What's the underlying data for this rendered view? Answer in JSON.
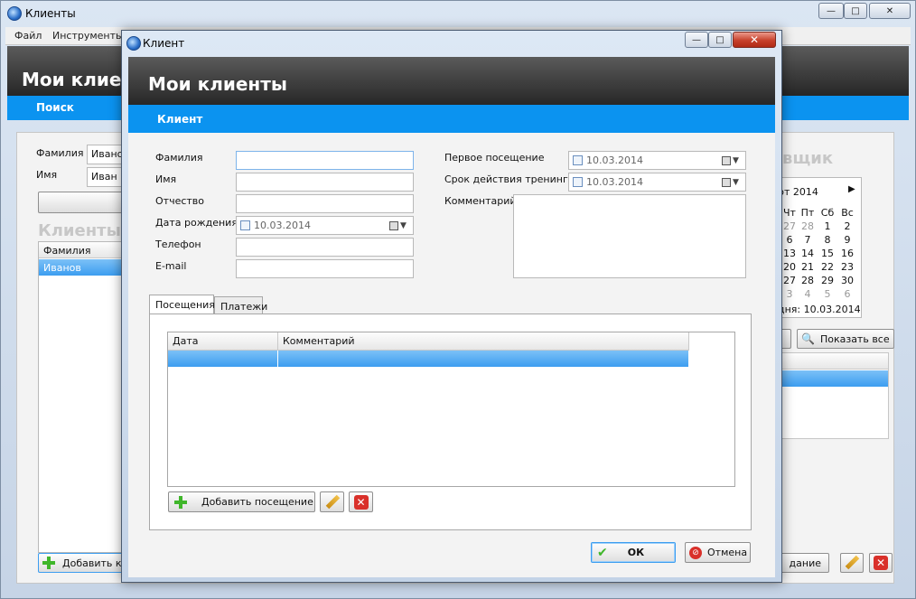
{
  "main": {
    "title": "Клиенты",
    "menu": [
      "Файл",
      "Инструменты"
    ],
    "header_title": "Мои клиенты",
    "search_bar_label": "Поиск",
    "search": {
      "surname_label": "Фамилия",
      "surname_value": "Иванов",
      "name_label": "Имя",
      "name_value": "Иван"
    },
    "clients_section_title": "Клиенты",
    "clients_table": {
      "header": "Фамилия",
      "rows": [
        "Иванов"
      ]
    },
    "add_button_label": "Добавить к",
    "right_section_title": "вщик",
    "calendar": {
      "month_label": "рт 2014",
      "weekdays": [
        "Чт",
        "Пт",
        "Сб",
        "Вс"
      ],
      "weeks": [
        [
          "27",
          "28",
          "1",
          "2"
        ],
        [
          "6",
          "7",
          "8",
          "9"
        ],
        [
          "13",
          "14",
          "15",
          "16"
        ],
        [
          "20",
          "21",
          "22",
          "23"
        ],
        [
          "27",
          "28",
          "29",
          "30"
        ],
        [
          "3",
          "4",
          "5",
          "6"
        ]
      ],
      "today_label": "дня: 10.03.2014"
    },
    "show_all_label": "Показать все",
    "partial_button_label": "дание"
  },
  "dialog": {
    "title": "Клиент",
    "header_title": "Мои клиенты",
    "bar_title": "Клиент",
    "fields": {
      "surname_label": "Фамилия",
      "name_label": "Имя",
      "patronymic_label": "Отчество",
      "birthdate_label": "Дата рождения",
      "birthdate_value": "10.03.2014",
      "phone_label": "Телефон",
      "email_label": "E-mail",
      "first_visit_label": "Первое посещение",
      "first_visit_value": "10.03.2014",
      "training_term_label": "Срок действия тренинга",
      "training_term_value": "10.03.2014",
      "comment_label": "Комментарий"
    },
    "tabs": [
      "Посещения",
      "Платежи"
    ],
    "grid_headers": [
      "Дата",
      "Комментарий"
    ],
    "add_visit_label": "Добавить посещение",
    "ok_label": "ОК",
    "cancel_label": "Отмена"
  },
  "colors": {
    "accent_blue": "#0b93f0",
    "header_dark": "#2a2a2a",
    "selection_blue": "#3c9df0",
    "close_red": "#c7402b"
  }
}
